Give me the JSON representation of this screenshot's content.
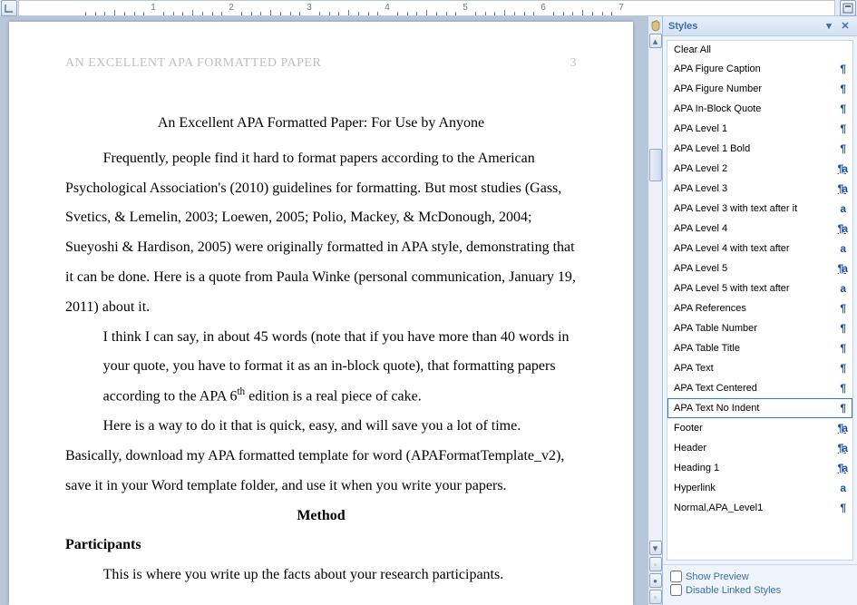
{
  "ruler": {
    "numbers": [
      "1",
      "2",
      "3",
      "4",
      "5",
      "6",
      "7"
    ]
  },
  "document": {
    "running_head": "AN EXCELLENT APA FORMATTED PAPER",
    "page_number": "3",
    "title": "An Excellent APA Formatted Paper: For Use by Anyone",
    "para1": "Frequently, people find it hard to format papers according to the American Psychological Association's (2010) guidelines for formatting. But most studies (Gass, Svetics, & Lemelin, 2003; Loewen, 2005; Polio, Mackey, & McDonough, 2004; Sueyoshi & Hardison, 2005) were originally formatted in APA style, demonstrating that it can be done. Here is a quote from Paula Winke (personal communication, January 19, 2011) about it.",
    "quote1": "I think I can say, in about 45 words (note that if you have more than 40 words in your quote, you have to format it as an in-block quote), that formatting papers according to the APA 6",
    "quote1_sup": "th",
    "quote1_after": " edition is a real piece of cake.",
    "para2": "Here is a way to do it that is quick, easy, and will save you a lot of time. Basically, download my APA formatted template for word (APAFormatTemplate_v2), save it in your Word template folder, and use it when you write your papers.",
    "method_head": "Method",
    "subhead": "Participants",
    "para3": "This is where you write up the facts about your research participants."
  },
  "styles_pane": {
    "title": "Styles",
    "clear_all": "Clear All",
    "items": [
      {
        "label": "APA Figure Caption",
        "glyph": "¶"
      },
      {
        "label": "APA Figure Number",
        "glyph": "¶"
      },
      {
        "label": "APA In-Block Quote",
        "glyph": "¶"
      },
      {
        "label": "APA Level 1",
        "glyph": "¶"
      },
      {
        "label": "APA Level 1 Bold",
        "glyph": "¶"
      },
      {
        "label": "APA Level 2",
        "glyph": "¶a"
      },
      {
        "label": "APA Level 3",
        "glyph": "¶a"
      },
      {
        "label": "APA Level 3 with text after it",
        "glyph": "a"
      },
      {
        "label": "APA Level 4",
        "glyph": "¶a"
      },
      {
        "label": "APA Level 4 with text after",
        "glyph": "a"
      },
      {
        "label": "APA Level 5",
        "glyph": "¶a"
      },
      {
        "label": "APA Level 5 with text after",
        "glyph": "a"
      },
      {
        "label": "APA References",
        "glyph": "¶"
      },
      {
        "label": "APA Table Number",
        "glyph": "¶"
      },
      {
        "label": "APA Table Title",
        "glyph": "¶"
      },
      {
        "label": "APA Text",
        "glyph": "¶"
      },
      {
        "label": "APA Text Centered",
        "glyph": "¶"
      },
      {
        "label": "APA Text No Indent",
        "glyph": "¶",
        "selected": true
      },
      {
        "label": "Footer",
        "glyph": "¶a"
      },
      {
        "label": "Header",
        "glyph": "¶a"
      },
      {
        "label": "Heading 1",
        "glyph": "¶a"
      },
      {
        "label": "Hyperlink",
        "glyph": "a"
      },
      {
        "label": "Normal,APA_Level1",
        "glyph": "¶"
      }
    ],
    "show_preview": "Show Preview",
    "disable_linked": "Disable Linked Styles"
  }
}
